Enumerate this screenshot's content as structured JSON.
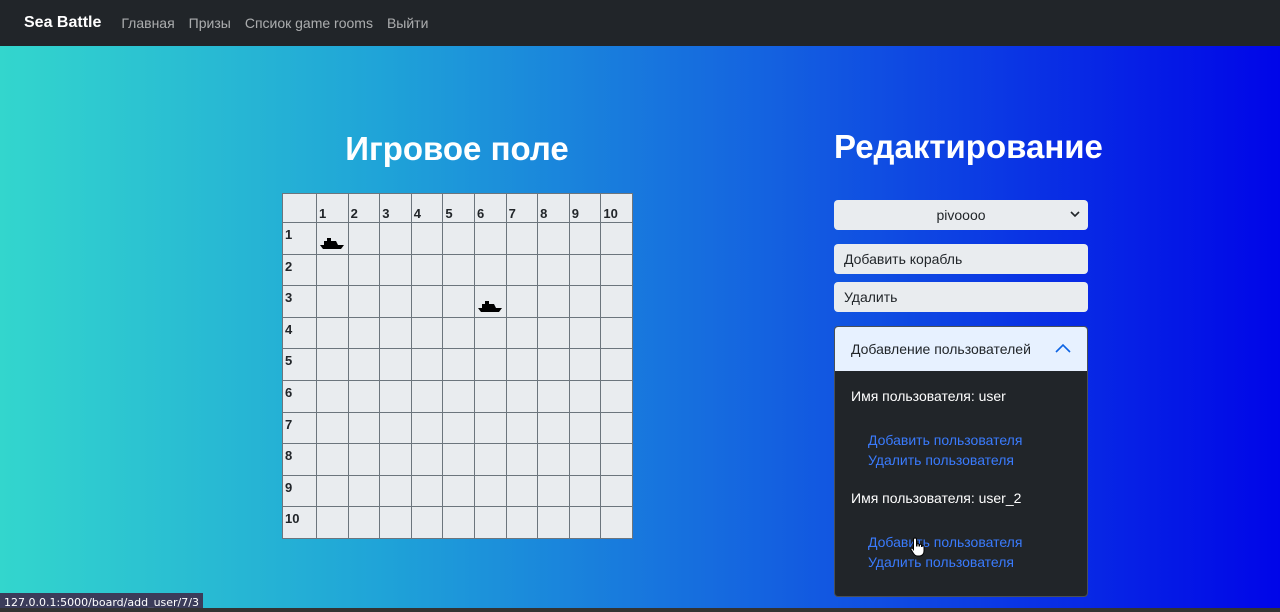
{
  "navbar": {
    "brand": "Sea Battle",
    "links": [
      "Главная",
      "Призы",
      "Спсиок game rooms",
      "Выйти"
    ]
  },
  "board": {
    "title": "Игровое поле",
    "col_headers": [
      "1",
      "2",
      "3",
      "4",
      "5",
      "6",
      "7",
      "8",
      "9",
      "10"
    ],
    "row_headers": [
      "1",
      "2",
      "3",
      "4",
      "5",
      "6",
      "7",
      "8",
      "9",
      "10"
    ],
    "ships": [
      {
        "row": 1,
        "col": 1,
        "icon": "ship-icon"
      },
      {
        "row": 3,
        "col": 6,
        "icon": "ship-icon"
      }
    ]
  },
  "editor": {
    "title": "Редактирование",
    "select_value": "pivoooo",
    "add_ship_label": "Добавить корабль",
    "delete_label": "Удалить",
    "accordion": {
      "header": "Добавление пользователей",
      "users": [
        {
          "name_label": "Имя пользователя: user",
          "add_label": "Добавить пользователя",
          "remove_label": "Удалить пользователя"
        },
        {
          "name_label": "Имя пользователя: user_2",
          "add_label": "Добавить пользователя",
          "remove_label": "Удалить пользователя"
        }
      ]
    }
  },
  "status_bar": "127.0.0.1:5000/board/add_user/7/3",
  "colors": {
    "navbar": "#212529",
    "link": "#3a7bfd",
    "cell": "#e9ecef"
  }
}
